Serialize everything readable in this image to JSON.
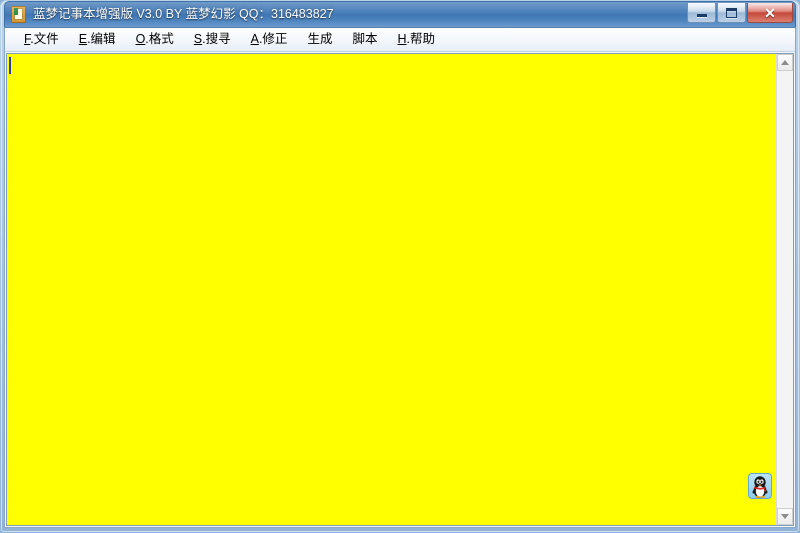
{
  "window": {
    "title": "蓝梦记事本增强版 V3.0 BY 蓝梦幻影 QQ：316483827",
    "app_icon": "notebook-icon",
    "controls": {
      "minimize_label": "—",
      "maximize_label": "□",
      "close_label": "✕"
    },
    "colors": {
      "titlebar_blue": "#4279b6",
      "close_red": "#c44a3c",
      "editor_yellow": "#ffff00",
      "frame_blue": "#a9c6e3",
      "caret_blue": "#2b3da8"
    }
  },
  "menubar": {
    "items": [
      {
        "accel": "F",
        "label": ".文件",
        "name": "menu-file"
      },
      {
        "accel": "E",
        "label": ".编辑",
        "name": "menu-edit"
      },
      {
        "accel": "O",
        "label": ".格式",
        "name": "menu-format"
      },
      {
        "accel": "S",
        "label": ".搜寻",
        "name": "menu-search"
      },
      {
        "accel": "A",
        "label": ".修正",
        "name": "menu-fix"
      },
      {
        "accel": "",
        "label": "生成",
        "name": "menu-generate"
      },
      {
        "accel": "",
        "label": "脚本",
        "name": "menu-script"
      },
      {
        "accel": "H",
        "label": ".帮助",
        "name": "menu-help"
      }
    ]
  },
  "editor": {
    "content": "",
    "background_color": "#ffff00",
    "caret_visible": true
  },
  "overlay": {
    "qq_icon_name": "qq-penguin-icon"
  },
  "scrollbar": {
    "up_arrow": "scroll-up-icon",
    "down_arrow": "scroll-down-icon"
  }
}
